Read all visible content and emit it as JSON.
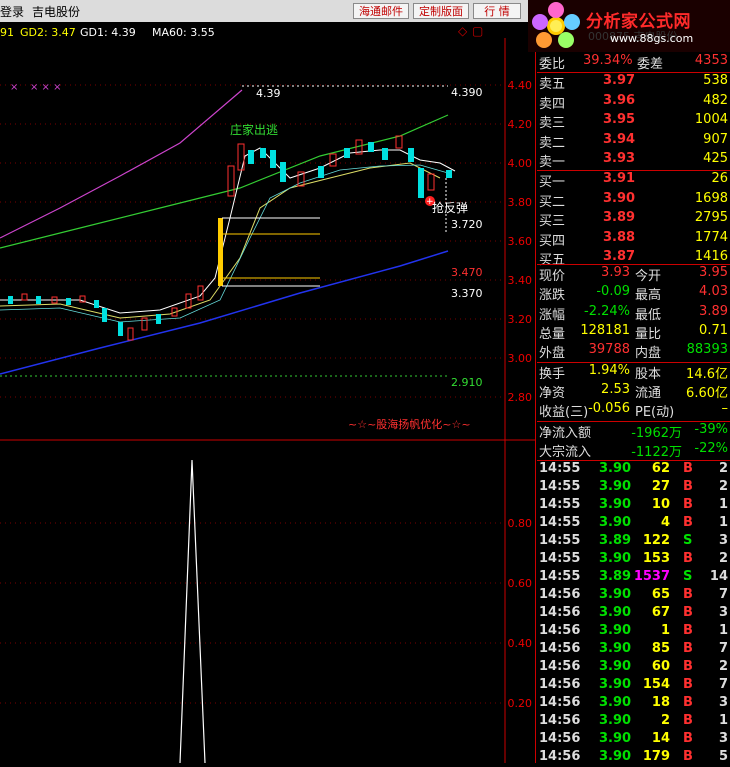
{
  "topbar": {
    "login": "登录",
    "stock_name": "吉电股份",
    "btn_mail": "海通邮件",
    "btn_layout": "定制版面",
    "btn_market": "行  情"
  },
  "logo": {
    "title": "分析家公式网",
    "url": "www.88gs.com",
    "code": "000875 吉电股份"
  },
  "indicator_header": {
    "prefix": "91",
    "gd2": "GD2: 3.47",
    "gd1": "GD1: 4.39",
    "ma60": "MA60: 3.55"
  },
  "chart_labels": {
    "high_label": "4.39",
    "high_line": "4.390",
    "escape": "庄家出逃",
    "rebound": "抢反弹",
    "line_3720": "3.720",
    "line_3470": "3.470",
    "line_3370": "3.370",
    "line_2910": "2.910",
    "watermark": "~☆~股海扬帆优化~☆~"
  },
  "y_axis_main": [
    "4.40",
    "4.20",
    "4.00",
    "3.80",
    "3.60",
    "3.40",
    "3.20",
    "3.00",
    "2.80"
  ],
  "y_axis_sub": [
    "0.80",
    "0.60",
    "0.40",
    "0.20"
  ],
  "quote": {
    "weibi_label": "委比",
    "weibi": "39.34%",
    "weicha_label": "委差",
    "weicha": "4353",
    "sell": [
      {
        "label": "卖五",
        "price": "3.97",
        "vol": "538"
      },
      {
        "label": "卖四",
        "price": "3.96",
        "vol": "482"
      },
      {
        "label": "卖三",
        "price": "3.95",
        "vol": "1004"
      },
      {
        "label": "卖二",
        "price": "3.94",
        "vol": "907"
      },
      {
        "label": "卖一",
        "price": "3.93",
        "vol": "425"
      }
    ],
    "buy": [
      {
        "label": "买一",
        "price": "3.91",
        "vol": "26"
      },
      {
        "label": "买二",
        "price": "3.90",
        "vol": "1698"
      },
      {
        "label": "买三",
        "price": "3.89",
        "vol": "2795"
      },
      {
        "label": "买四",
        "price": "3.88",
        "vol": "1774"
      },
      {
        "label": "买五",
        "price": "3.87",
        "vol": "1416"
      }
    ],
    "stats": [
      {
        "l1": "现价",
        "v1": "3.93",
        "l2": "今开",
        "v2": "3.95"
      },
      {
        "l1": "涨跌",
        "v1": "-0.09",
        "l2": "最高",
        "v2": "4.03"
      },
      {
        "l1": "涨幅",
        "v1": "-2.24%",
        "l2": "最低",
        "v2": "3.89"
      },
      {
        "l1": "总量",
        "v1": "128181",
        "l2": "量比",
        "v2": "0.71"
      },
      {
        "l1": "外盘",
        "v1": "39788",
        "l2": "内盘",
        "v2": "88393"
      }
    ],
    "fund": [
      {
        "l1": "换手",
        "v1": "1.94%",
        "l2": "股本",
        "v2": "14.6亿"
      },
      {
        "l1": "净资",
        "v1": "2.53",
        "l2": "流通",
        "v2": "6.60亿"
      },
      {
        "l1": "收益(三)",
        "v1": "-0.056",
        "l2": "PE(动)",
        "v2": "–"
      }
    ],
    "flow": [
      {
        "label": "净流入额",
        "val": "-1962万",
        "pct": "-39%"
      },
      {
        "label": "大宗流入",
        "val": "-1122万",
        "pct": "-22%"
      }
    ]
  },
  "ticks": [
    {
      "time": "14:55",
      "price": "3.90",
      "vol": "62",
      "side": "B",
      "n": "2"
    },
    {
      "time": "14:55",
      "price": "3.90",
      "vol": "27",
      "side": "B",
      "n": "2"
    },
    {
      "time": "14:55",
      "price": "3.90",
      "vol": "10",
      "side": "B",
      "n": "1"
    },
    {
      "time": "14:55",
      "price": "3.90",
      "vol": "4",
      "side": "B",
      "n": "1"
    },
    {
      "time": "14:55",
      "price": "3.89",
      "vol": "122",
      "side": "S",
      "n": "3"
    },
    {
      "time": "14:55",
      "price": "3.90",
      "vol": "153",
      "side": "B",
      "n": "2"
    },
    {
      "time": "14:55",
      "price": "3.89",
      "vol": "1537",
      "side": "S",
      "n": "14"
    },
    {
      "time": "14:56",
      "price": "3.90",
      "vol": "65",
      "side": "B",
      "n": "7"
    },
    {
      "time": "14:56",
      "price": "3.90",
      "vol": "67",
      "side": "B",
      "n": "3"
    },
    {
      "time": "14:56",
      "price": "3.90",
      "vol": "1",
      "side": "B",
      "n": "1"
    },
    {
      "time": "14:56",
      "price": "3.90",
      "vol": "85",
      "side": "B",
      "n": "7"
    },
    {
      "time": "14:56",
      "price": "3.90",
      "vol": "60",
      "side": "B",
      "n": "2"
    },
    {
      "time": "14:56",
      "price": "3.90",
      "vol": "154",
      "side": "B",
      "n": "7"
    },
    {
      "time": "14:56",
      "price": "3.90",
      "vol": "18",
      "side": "B",
      "n": "3"
    },
    {
      "time": "14:56",
      "price": "3.90",
      "vol": "2",
      "side": "B",
      "n": "1"
    },
    {
      "time": "14:56",
      "price": "3.90",
      "vol": "14",
      "side": "B",
      "n": "3"
    },
    {
      "time": "14:56",
      "price": "3.90",
      "vol": "179",
      "side": "B",
      "n": "5"
    }
  ],
  "colors": {
    "up": "#ff3030",
    "down": "#00e0e0",
    "yellow": "#ffff00",
    "white": "#ffffff",
    "red": "#ff0000",
    "magenta": "#ff00ff"
  }
}
